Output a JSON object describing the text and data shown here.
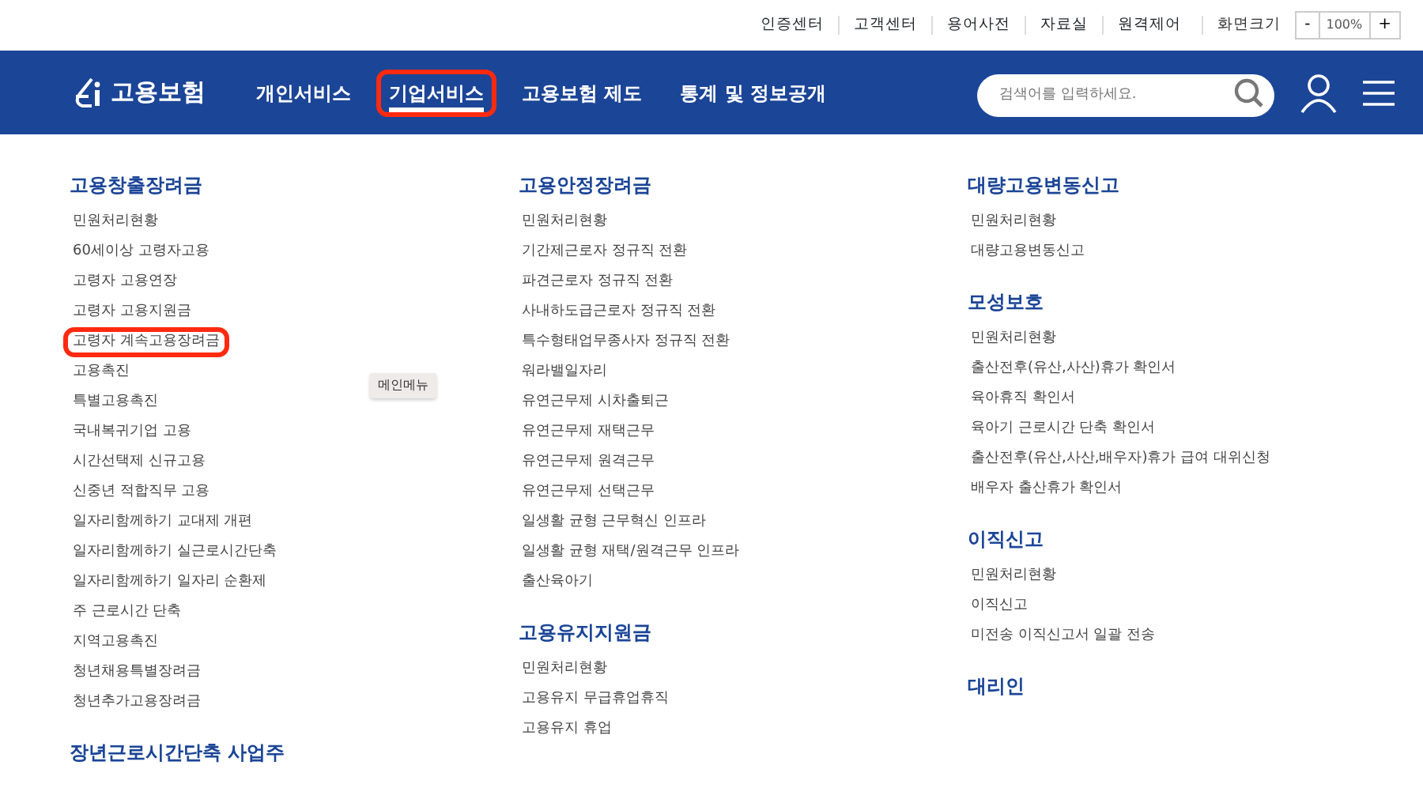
{
  "utility_links": [
    "인증센터",
    "고객센터",
    "용어사전",
    "자료실",
    "원격제어"
  ],
  "zoom_control": {
    "label": "화면크기",
    "minus": "-",
    "value": "100%",
    "plus": "+"
  },
  "logo": {
    "text": "고용보험"
  },
  "nav": [
    {
      "label": "개인서비스",
      "selected": false,
      "highlighted": false
    },
    {
      "label": "기업서비스",
      "selected": true,
      "highlighted": true
    },
    {
      "label": "고용보험 제도",
      "selected": false,
      "highlighted": false
    },
    {
      "label": "통계 및 정보공개",
      "selected": false,
      "highlighted": false
    }
  ],
  "search": {
    "placeholder": "검색어를 입력하세요."
  },
  "tooltip": "메인메뉴",
  "columns": [
    [
      {
        "title": "고용창출장려금",
        "items": [
          {
            "label": "민원처리현황",
            "highlighted": false
          },
          {
            "label": "60세이상 고령자고용",
            "highlighted": false
          },
          {
            "label": "고령자 고용연장",
            "highlighted": false
          },
          {
            "label": "고령자 고용지원금",
            "highlighted": false
          },
          {
            "label": "고령자 계속고용장려금",
            "highlighted": true
          },
          {
            "label": "고용촉진",
            "highlighted": false
          },
          {
            "label": "특별고용촉진",
            "highlighted": false
          },
          {
            "label": "국내복귀기업 고용",
            "highlighted": false
          },
          {
            "label": "시간선택제 신규고용",
            "highlighted": false
          },
          {
            "label": "신중년 적합직무 고용",
            "highlighted": false
          },
          {
            "label": "일자리함께하기 교대제 개편",
            "highlighted": false
          },
          {
            "label": "일자리함께하기 실근로시간단축",
            "highlighted": false
          },
          {
            "label": "일자리함께하기 일자리 순환제",
            "highlighted": false
          },
          {
            "label": "주 근로시간 단축",
            "highlighted": false
          },
          {
            "label": "지역고용촉진",
            "highlighted": false
          },
          {
            "label": "청년채용특별장려금",
            "highlighted": false
          },
          {
            "label": "청년추가고용장려금",
            "highlighted": false
          }
        ]
      },
      {
        "title": "장년근로시간단축 사업주"
      }
    ],
    [
      {
        "title": "고용안정장려금",
        "items": [
          {
            "label": "민원처리현황",
            "highlighted": false
          },
          {
            "label": "기간제근로자 정규직 전환",
            "highlighted": false
          },
          {
            "label": "파견근로자 정규직 전환",
            "highlighted": false
          },
          {
            "label": "사내하도급근로자 정규직 전환",
            "highlighted": false
          },
          {
            "label": "특수형태업무종사자 정규직 전환",
            "highlighted": false
          },
          {
            "label": "워라밸일자리",
            "highlighted": false
          },
          {
            "label": "유연근무제 시차출퇴근",
            "highlighted": false
          },
          {
            "label": "유연근무제 재택근무",
            "highlighted": false
          },
          {
            "label": "유연근무제 원격근무",
            "highlighted": false
          },
          {
            "label": "유연근무제 선택근무",
            "highlighted": false
          },
          {
            "label": "일생활 균형 근무혁신 인프라",
            "highlighted": false
          },
          {
            "label": "일생활 균형 재택/원격근무 인프라",
            "highlighted": false
          },
          {
            "label": "출산육아기",
            "highlighted": false
          }
        ]
      },
      {
        "title": "고용유지지원금",
        "items": [
          {
            "label": "민원처리현황",
            "highlighted": false
          },
          {
            "label": "고용유지 무급휴업휴직",
            "highlighted": false
          },
          {
            "label": "고용유지 휴업",
            "highlighted": false
          }
        ]
      }
    ],
    [
      {
        "title": "대량고용변동신고",
        "items": [
          {
            "label": "민원처리현황",
            "highlighted": false
          },
          {
            "label": "대량고용변동신고",
            "highlighted": false
          }
        ]
      },
      {
        "title": "모성보호",
        "items": [
          {
            "label": "민원처리현황",
            "highlighted": false
          },
          {
            "label": "출산전후(유산,사산)휴가 확인서",
            "highlighted": false
          },
          {
            "label": "육아휴직 확인서",
            "highlighted": false
          },
          {
            "label": "육아기 근로시간 단축 확인서",
            "highlighted": false
          },
          {
            "label": "출산전후(유산,사산,배우자)휴가 급여 대위신청",
            "highlighted": false
          },
          {
            "label": "배우자 출산휴가 확인서",
            "highlighted": false
          }
        ]
      },
      {
        "title": "이직신고",
        "items": [
          {
            "label": "민원처리현황",
            "highlighted": false
          },
          {
            "label": "이직신고",
            "highlighted": false
          },
          {
            "label": "미전송 이직신고서 일괄 전송",
            "highlighted": false
          }
        ]
      },
      {
        "title": "대리인"
      }
    ]
  ]
}
